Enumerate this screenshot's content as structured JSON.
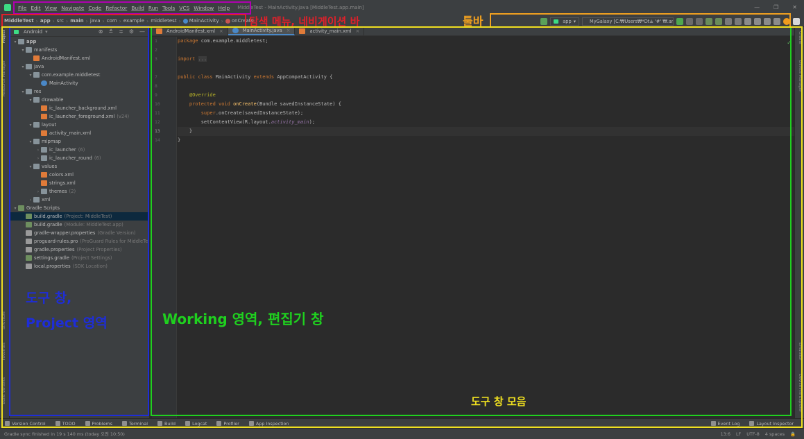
{
  "window": {
    "title": "MiddleTest - MainActivity.java [MiddleTest.app.main]",
    "controls": [
      "—",
      "❐",
      "✕"
    ]
  },
  "menu": [
    "File",
    "Edit",
    "View",
    "Navigate",
    "Code",
    "Refactor",
    "Build",
    "Run",
    "Tools",
    "VCS",
    "Window",
    "Help"
  ],
  "breadcrumbs": [
    "MiddleTest",
    "app",
    "src",
    "main",
    "java",
    "com",
    "example",
    "middletest",
    "MainActivity",
    "onCreate"
  ],
  "toolbar": {
    "config": "app",
    "device": "MyGalaxy [C:₩Users₩*Dt± '#' ₩.and..."
  },
  "project": {
    "view": "Android",
    "tree": [
      {
        "label": "app",
        "depth": 0,
        "arrow": "▾",
        "icon": "fold",
        "bold": true
      },
      {
        "label": "manifests",
        "depth": 1,
        "arrow": "▾",
        "icon": "fold"
      },
      {
        "label": "AndroidManifest.xml",
        "depth": 2,
        "arrow": "",
        "icon": "xml"
      },
      {
        "label": "java",
        "depth": 1,
        "arrow": "▾",
        "icon": "fold"
      },
      {
        "label": "com.example.middletest",
        "depth": 2,
        "arrow": "▾",
        "icon": "fold"
      },
      {
        "label": "MainActivity",
        "depth": 3,
        "arrow": "",
        "icon": "java"
      },
      {
        "label": "res",
        "depth": 1,
        "arrow": "▾",
        "icon": "fold"
      },
      {
        "label": "drawable",
        "depth": 2,
        "arrow": "▾",
        "icon": "fold"
      },
      {
        "label": "ic_launcher_background.xml",
        "depth": 3,
        "arrow": "",
        "icon": "xml"
      },
      {
        "label": "ic_launcher_foreground.xml",
        "depth": 3,
        "arrow": "",
        "icon": "xml",
        "dim": "(v24)"
      },
      {
        "label": "layout",
        "depth": 2,
        "arrow": "▾",
        "icon": "fold"
      },
      {
        "label": "activity_main.xml",
        "depth": 3,
        "arrow": "",
        "icon": "xml"
      },
      {
        "label": "mipmap",
        "depth": 2,
        "arrow": "▾",
        "icon": "fold"
      },
      {
        "label": "ic_launcher",
        "depth": 3,
        "arrow": "›",
        "icon": "fold",
        "dim": "(6)"
      },
      {
        "label": "ic_launcher_round",
        "depth": 3,
        "arrow": "›",
        "icon": "fold",
        "dim": "(6)"
      },
      {
        "label": "values",
        "depth": 2,
        "arrow": "▾",
        "icon": "fold"
      },
      {
        "label": "colors.xml",
        "depth": 3,
        "arrow": "",
        "icon": "xml"
      },
      {
        "label": "strings.xml",
        "depth": 3,
        "arrow": "",
        "icon": "xml"
      },
      {
        "label": "themes",
        "depth": 3,
        "arrow": "›",
        "icon": "fold",
        "dim": "(2)"
      },
      {
        "label": "xml",
        "depth": 2,
        "arrow": "›",
        "icon": "fold"
      },
      {
        "label": "Gradle Scripts",
        "depth": 0,
        "arrow": "▾",
        "icon": "gradle"
      },
      {
        "label": "build.gradle",
        "depth": 1,
        "arrow": "",
        "icon": "gradle",
        "dim": "(Project: MiddleTest)",
        "selected": true
      },
      {
        "label": "build.gradle",
        "depth": 1,
        "arrow": "",
        "icon": "gradle",
        "dim": "(Module: MiddleTest.app)"
      },
      {
        "label": "gradle-wrapper.properties",
        "depth": 1,
        "arrow": "",
        "icon": "props",
        "dim": "(Gradle Version)"
      },
      {
        "label": "proguard-rules.pro",
        "depth": 1,
        "arrow": "",
        "icon": "props",
        "dim": "(ProGuard Rules for MiddleTe"
      },
      {
        "label": "gradle.properties",
        "depth": 1,
        "arrow": "",
        "icon": "props",
        "dim": "(Project Properties)"
      },
      {
        "label": "settings.gradle",
        "depth": 1,
        "arrow": "",
        "icon": "gradle",
        "dim": "(Project Settings)"
      },
      {
        "label": "local.properties",
        "depth": 1,
        "arrow": "",
        "icon": "props",
        "dim": "(SDK Location)"
      }
    ]
  },
  "editor": {
    "tabs": [
      {
        "label": "AndroidManifest.xml",
        "icon": "xml",
        "active": false
      },
      {
        "label": "MainActivity.java",
        "icon": "java",
        "active": true
      },
      {
        "label": "activity_main.xml",
        "icon": "xml",
        "active": false
      }
    ],
    "line_numbers": [
      "1",
      "2",
      "3",
      "7",
      "8",
      "9",
      "10",
      "11",
      "12",
      "13",
      "14"
    ],
    "code": {
      "l1a": "package ",
      "l1b": "com.example.middletest;",
      "l3a": "import ",
      "l3b": "...",
      "l8a": "public class ",
      "l8b": "MainActivity ",
      "l8c": "extends ",
      "l8d": "AppCompatActivity {",
      "l10": "    @Override",
      "l11a": "    protected void ",
      "l11b": "onCreate",
      "l11c": "(Bundle savedInstanceState) {",
      "l12a": "        super",
      "l12b": ".onCreate(savedInstanceState);",
      "l13a": "        setContentView(R.layout.",
      "l13b": "activity_main",
      "l13c": ");",
      "l14": "    }",
      "l15": "}"
    }
  },
  "left_strip": [
    "Project",
    "Resource Manager",
    "Structure",
    "Favorites",
    "Build Variants"
  ],
  "right_strip": [
    "Gradle",
    "Device Manager",
    "Emulator",
    "Device File Explorer"
  ],
  "bottom_tools": [
    "Version Control",
    "TODO",
    "Problems",
    "Terminal",
    "Build",
    "Logcat",
    "Profiler",
    "App Inspection"
  ],
  "bottom_right_tools": [
    "Event Log",
    "Layout Inspector"
  ],
  "status": {
    "message": "Gradle sync finished in 19 s 140 ms (today 오전 10:50)",
    "right": [
      "13:6",
      "LF",
      "UTF-8",
      "4 spaces"
    ]
  },
  "annotations": {
    "menu_nav": "탐색 메뉴, 네비게이션 바",
    "toolbar": "툴바",
    "project": "도구 창,\nProject 영역",
    "working": "Working 영역, 편집기 창",
    "tools": "도구 창 모음"
  },
  "annotation_colors": {
    "menu": "#b000b0",
    "nav": "#e0202a",
    "toolbar": "#f0a020",
    "project": "#1e2dd8",
    "working": "#1fd01f",
    "tools": "#f0e020"
  }
}
